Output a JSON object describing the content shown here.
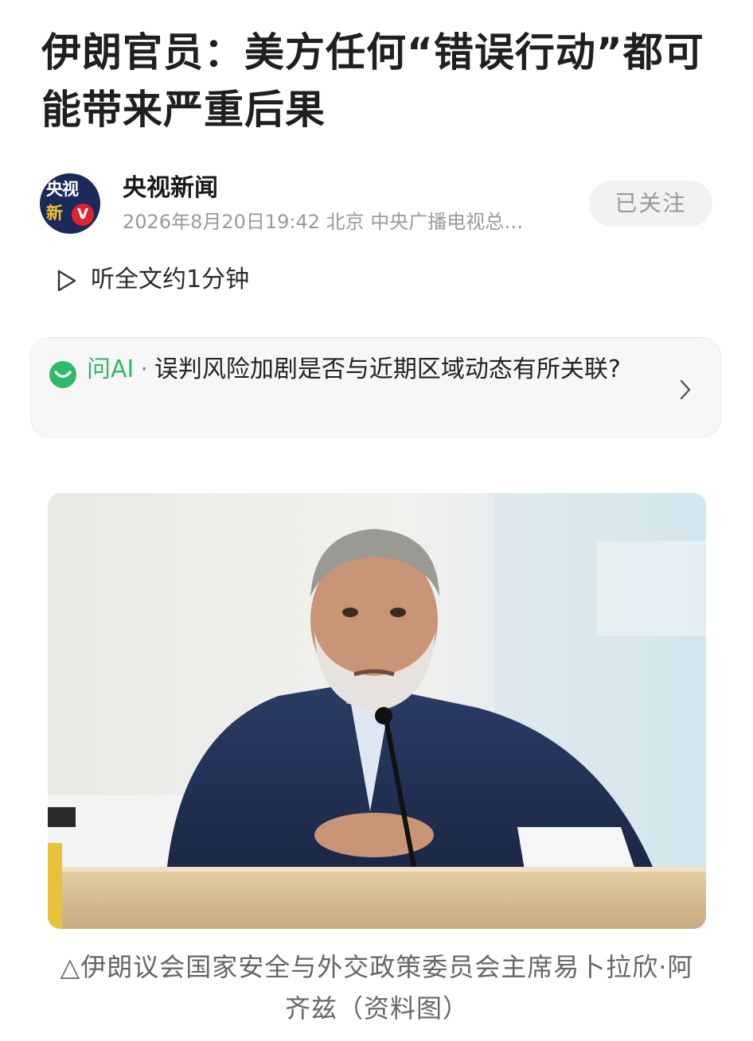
{
  "article": {
    "title": "伊朗官员：美方任何“错误行动”都可能带来严重后果"
  },
  "source": {
    "avatar_line1": "央视",
    "avatar_line2": "新",
    "avatar_badge": "V",
    "name": "央视新闻",
    "meta": "2026年8月20日19:42 北京 中央广播电视总…",
    "follow_label": "已关注"
  },
  "listen": {
    "label": "听全文约1分钟",
    "icon": "play-outline-icon"
  },
  "ai_suggestion": {
    "label": "问AI",
    "separator": "·",
    "question": "误判风险加剧是否与近期区域动态有所关联?",
    "icon": "ai-chat-icon",
    "accent": "#2fb96b"
  },
  "photo": {
    "caption": "△伊朗议会国家安全与外交政策委员会主席易卜拉欣·阿齐兹（资料图）"
  },
  "colors": {
    "text": "#1f1f1f",
    "muted": "#9a9a9a",
    "card_bg": "#f7f7f7",
    "avatar_bg": "#1c2a5a",
    "badge_red": "#e0232d"
  }
}
